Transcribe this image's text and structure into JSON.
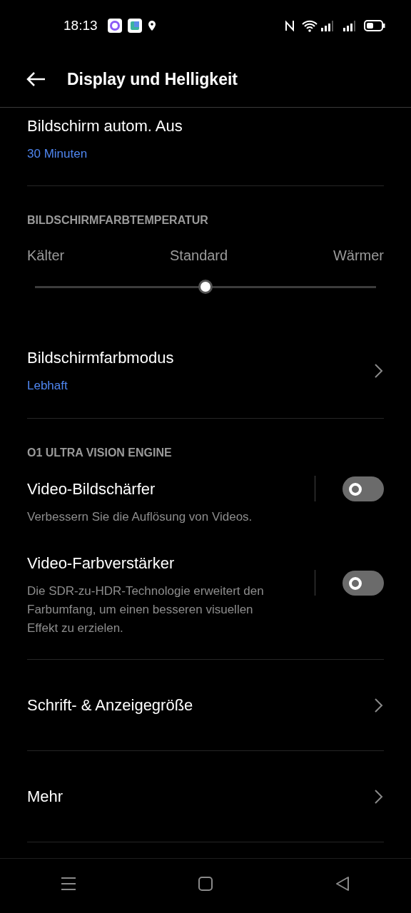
{
  "status_bar": {
    "time": "18:13"
  },
  "header": {
    "title": "Display und Helligkeit"
  },
  "items": [
    {
      "kind": "nav",
      "title": "Bildschirm autom. Aus",
      "value": "30 Minuten",
      "chevron": false
    },
    {
      "kind": "section",
      "title": "BILDSCHIRMFARBTEMPERATUR"
    },
    {
      "kind": "slider",
      "labels": [
        "Kälter",
        "Standard",
        "Wärmer"
      ],
      "level": 0.5
    },
    {
      "kind": "nav",
      "title": "Bildschirmfarbmodus",
      "value": "Lebhaft",
      "chevron": true
    },
    {
      "kind": "section",
      "title": "O1 ULTRA VISION ENGINE"
    },
    {
      "kind": "toggle",
      "title": "Video-Bildschärfer",
      "description": "Verbessern Sie die Auflösung von Videos.",
      "on": false
    },
    {
      "kind": "toggle",
      "title": "Video-Farbverstärker",
      "description": "Die SDR-zu-HDR-Technologie erweitert den Farbumfang, um einen besseren visuellen Effekt zu erzielen.",
      "on": false
    },
    {
      "kind": "link",
      "title": "Schrift- & Anzeigegröße",
      "chevron": true
    },
    {
      "kind": "link",
      "title": "Mehr",
      "chevron": true
    }
  ]
}
